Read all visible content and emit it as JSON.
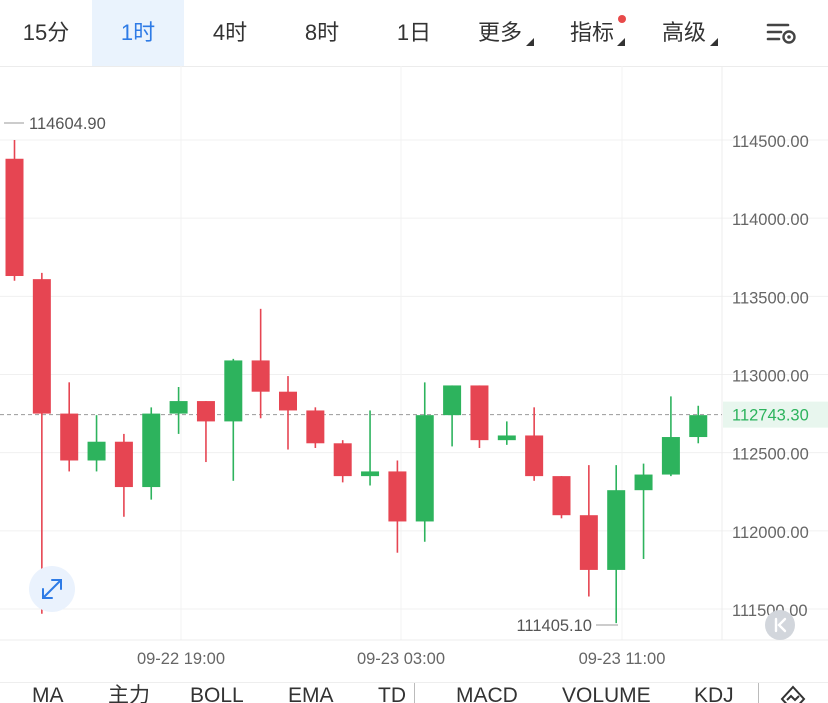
{
  "tabs": [
    {
      "label": "15分"
    },
    {
      "label": "1时",
      "active": true
    },
    {
      "label": "4时"
    },
    {
      "label": "8时"
    },
    {
      "label": "1日"
    },
    {
      "label": "更多"
    },
    {
      "label": "指标"
    },
    {
      "label": "高级"
    }
  ],
  "indicators": [
    "MA",
    "主力",
    "BOLL",
    "EMA",
    "TD",
    "MACD",
    "VOLUME",
    "KDJ"
  ],
  "colors": {
    "up": "#2db35d",
    "down": "#e64552",
    "accent": "#2e7be6",
    "last_price_bg": "#e8f6ee"
  },
  "icons": {
    "settings": "settings-sliders-icon",
    "expand": "expand-arrows-icon",
    "scroll_latest": "double-chevron-left-icon",
    "drawing": "drawing-tool-icon"
  },
  "chart_data": {
    "type": "candlestick",
    "y_axis_labels": [
      "114500.00",
      "114000.00",
      "113500.00",
      "113000.00",
      "112500.00",
      "112000.00",
      "111500.00"
    ],
    "y_ticks": [
      114500,
      114000,
      113500,
      113000,
      112500,
      112000,
      111500
    ],
    "x_labels": [
      "09-22 19:00",
      "09-23 03:00",
      "09-23 11:00"
    ],
    "high_label": "114604.90",
    "low_label": "111405.10",
    "last_price": 112743.3,
    "last_price_label": "112743.30",
    "candles": [
      {
        "o": 114380,
        "h": 114500,
        "l": 113600,
        "c": 113630
      },
      {
        "o": 113610,
        "h": 113650,
        "l": 111470,
        "c": 112750
      },
      {
        "o": 112750,
        "h": 112950,
        "l": 112380,
        "c": 112450
      },
      {
        "o": 112450,
        "h": 112740,
        "l": 112380,
        "c": 112570
      },
      {
        "o": 112570,
        "h": 112620,
        "l": 112090,
        "c": 112280
      },
      {
        "o": 112280,
        "h": 112790,
        "l": 112200,
        "c": 112750
      },
      {
        "o": 112750,
        "h": 112920,
        "l": 112620,
        "c": 112830
      },
      {
        "o": 112830,
        "h": 112830,
        "l": 112440,
        "c": 112700
      },
      {
        "o": 112700,
        "h": 113100,
        "l": 112320,
        "c": 113090
      },
      {
        "o": 113090,
        "h": 113420,
        "l": 112720,
        "c": 112890
      },
      {
        "o": 112890,
        "h": 112990,
        "l": 112520,
        "c": 112770
      },
      {
        "o": 112770,
        "h": 112790,
        "l": 112530,
        "c": 112560
      },
      {
        "o": 112560,
        "h": 112580,
        "l": 112310,
        "c": 112350
      },
      {
        "o": 112350,
        "h": 112770,
        "l": 112290,
        "c": 112380
      },
      {
        "o": 112380,
        "h": 112450,
        "l": 111860,
        "c": 112060
      },
      {
        "o": 112060,
        "h": 112950,
        "l": 111930,
        "c": 112740
      },
      {
        "o": 112740,
        "h": 112930,
        "l": 112540,
        "c": 112930
      },
      {
        "o": 112930,
        "h": 112930,
        "l": 112530,
        "c": 112580
      },
      {
        "o": 112580,
        "h": 112700,
        "l": 112550,
        "c": 112610
      },
      {
        "o": 112610,
        "h": 112790,
        "l": 112320,
        "c": 112350
      },
      {
        "o": 112350,
        "h": 112350,
        "l": 112080,
        "c": 112100
      },
      {
        "o": 112100,
        "h": 112420,
        "l": 111580,
        "c": 111750
      },
      {
        "o": 111750,
        "h": 112420,
        "l": 111410,
        "c": 112260
      },
      {
        "o": 112260,
        "h": 112430,
        "l": 111820,
        "c": 112360
      },
      {
        "o": 112360,
        "h": 112860,
        "l": 112350,
        "c": 112600
      },
      {
        "o": 112600,
        "h": 112800,
        "l": 112560,
        "c": 112740
      }
    ]
  }
}
